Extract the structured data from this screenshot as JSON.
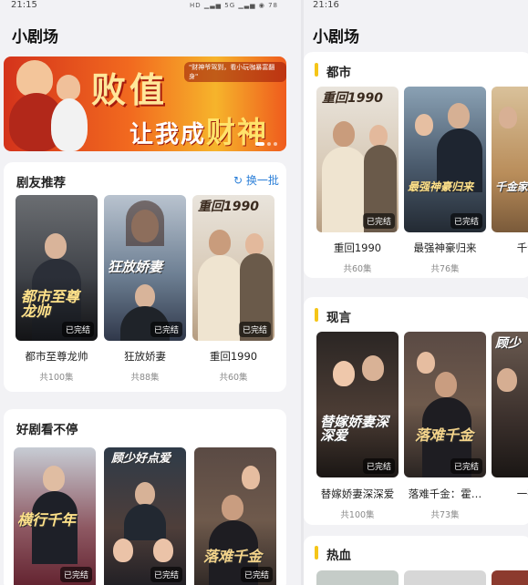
{
  "left": {
    "status_time": "21:15",
    "status_icons": "HD ▁▃▅ 5G ▁▃▅ ◉ 78",
    "title": "小剧场",
    "banner": {
      "headline": "败值",
      "line2_prefix": "让我成",
      "line2_gold": "财神",
      "tagline": "\"财神爷驾到，看小玩咖暴富翻身\""
    },
    "recommend": {
      "title": "剧友推荐",
      "refresh": "换一批",
      "items": [
        {
          "art": "都市至尊龙帅",
          "name": "都市至尊龙帅",
          "episodes": "共100集",
          "badge": "已完结"
        },
        {
          "art": "狂放娇妻",
          "name": "狂放娇妻",
          "episodes": "共88集",
          "badge": "已完结"
        },
        {
          "art": "重回1990",
          "name": "重回1990",
          "episodes": "共60集",
          "badge": "已完结"
        }
      ]
    },
    "binge": {
      "title": "好剧看不停",
      "items": [
        {
          "art": "横行千年",
          "badge": "已完结"
        },
        {
          "art": "顾少好点爱",
          "badge": "已完结"
        },
        {
          "art": "落难千金",
          "badge": "已完结"
        }
      ]
    }
  },
  "right": {
    "status_time": "21:16",
    "status_icons": "HD ▁▃▅ 5G ▁▃▅ ◉",
    "title": "小剧场",
    "urban": {
      "title": "都市",
      "items": [
        {
          "art": "重回1990",
          "name": "重回1990",
          "episodes": "共60集",
          "badge": "已完结"
        },
        {
          "art": "最强神豪归来",
          "name": "最强神豪归来",
          "episodes": "共76集",
          "badge": "已完结"
        },
        {
          "art": "千金家",
          "name": "千金家",
          "episodes": "共",
          "badge": ""
        }
      ]
    },
    "romance": {
      "title": "现言",
      "items": [
        {
          "art": "替嫁娇妻深深爱",
          "name": "替嫁娇妻深深爱",
          "episodes": "共100集",
          "badge": "已完结"
        },
        {
          "art": "落难千金",
          "name": "落难千金：霍…",
          "episodes": "共73集",
          "badge": "已完结"
        },
        {
          "art": "顾少",
          "name": "一夜惊",
          "episodes": "",
          "badge": ""
        }
      ]
    },
    "action": {
      "title": "热血"
    }
  }
}
